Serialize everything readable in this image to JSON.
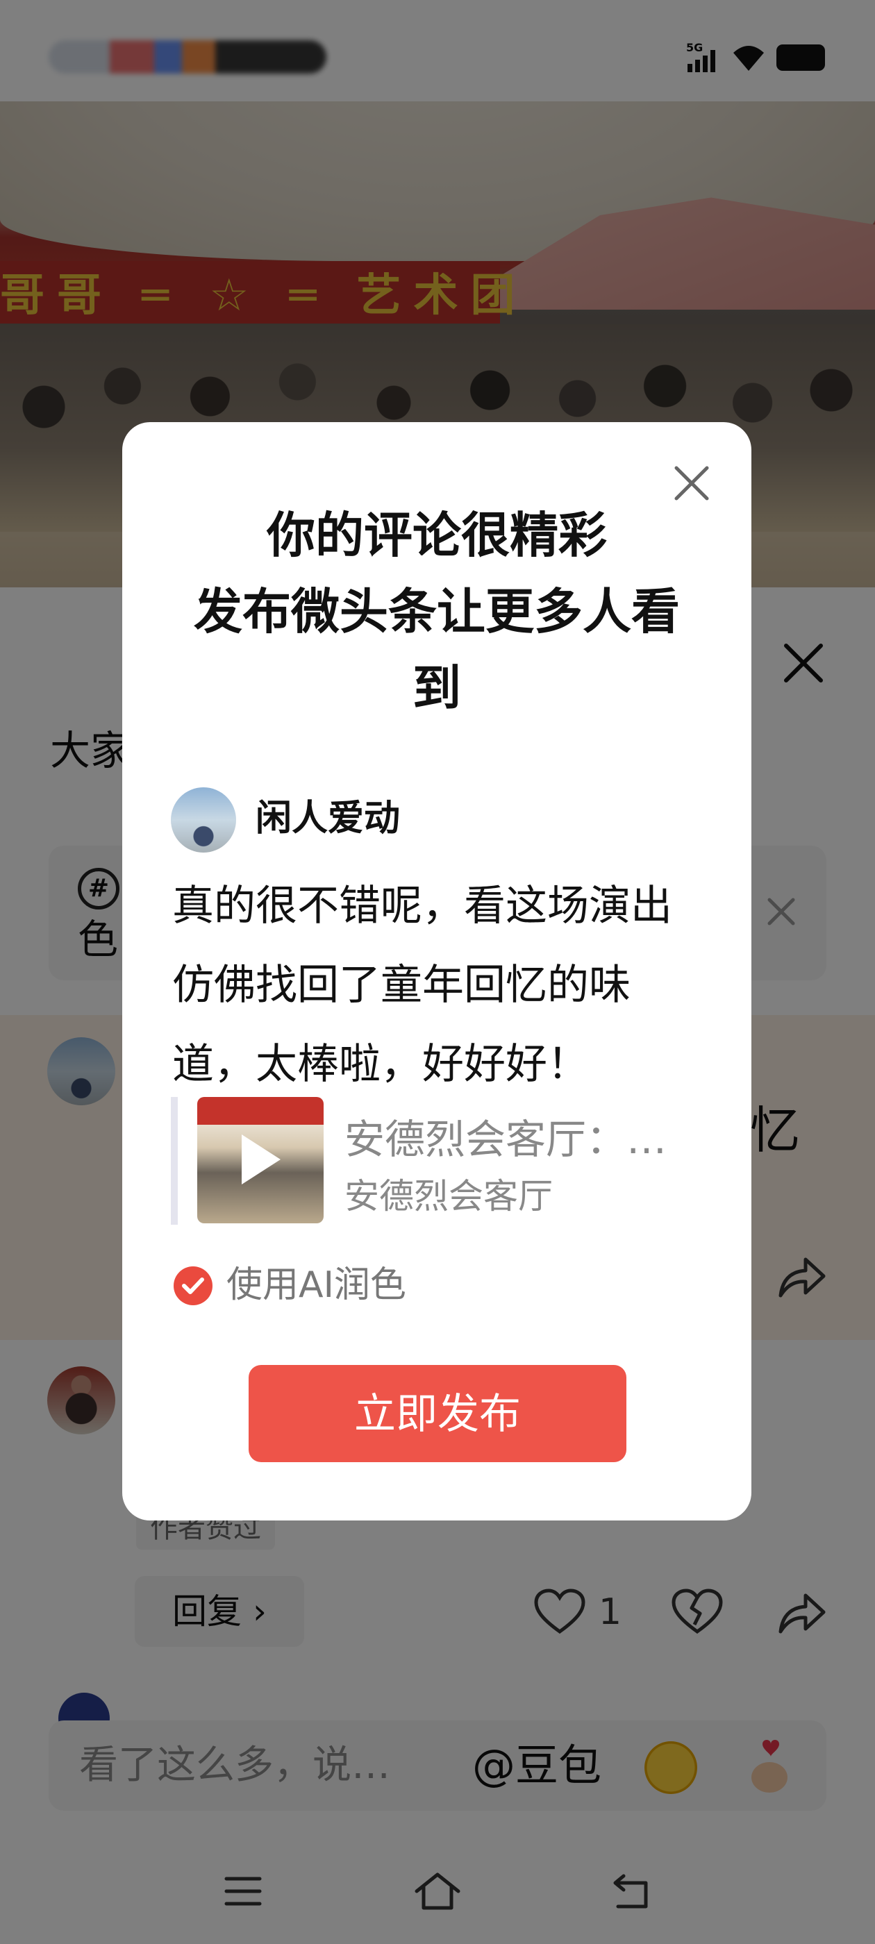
{
  "sheet": {
    "partial_title": "大家",
    "topic_partial": "色"
  },
  "comments": {
    "row1_partial_text": "忆",
    "author_liked": "作者赞过",
    "reply_label": "回复 ›",
    "like_count": "1"
  },
  "input_bar": {
    "placeholder": "看了这么多，说…",
    "mention": "@豆包"
  },
  "modal": {
    "title_line1": "你的评论很精彩",
    "title_line2": "发布微头条让更多人看",
    "title_line3": "到",
    "user_name": "闲人爱动",
    "comment_text": "真的很不错呢，看这场演出仿佛找回了童年回忆的味道，太棒啦，好好好！",
    "quote_title": "安德烈会客厅：…",
    "quote_subtitle": "安德烈会客厅",
    "ai_option_label": "使用AI润色",
    "ai_option_checked": true,
    "publish_label": "立即发布"
  },
  "video": {
    "banner_text": "哥哥 ═ ☆ ═ 艺术团"
  },
  "colors": {
    "accent_red": "#ee5449",
    "check_red": "#ea4a3e",
    "overlay": "rgba(0,0,0,0.5)"
  }
}
